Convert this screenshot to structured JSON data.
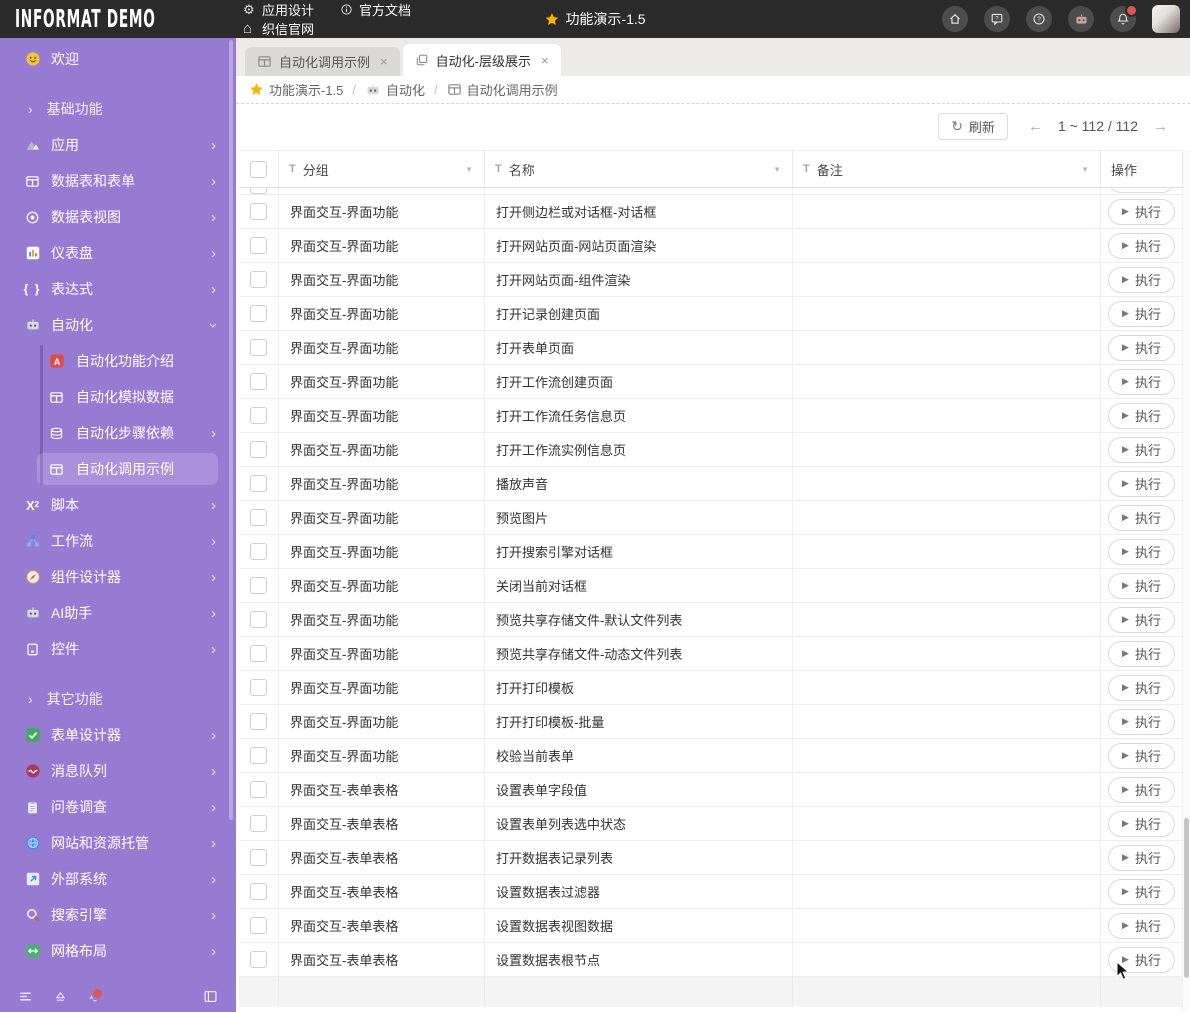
{
  "colors": {
    "accent_purple": "#977bd3",
    "topbar_bg": "#2b2b2b",
    "badge_red": "#e0564a",
    "star_yellow": "#f7b500"
  },
  "topbar": {
    "logo": "INFORMAT DEMO",
    "menu": [
      {
        "icon": "gear-icon",
        "label": "应用设计"
      },
      {
        "icon": "info-icon",
        "label": "官方文档"
      },
      {
        "icon": "home-icon",
        "label": "织信官网"
      }
    ],
    "title": {
      "icon": "star-icon",
      "label": "功能演示-1.5"
    },
    "actions": [
      {
        "icon": "home-circle-icon",
        "name": "home-button",
        "badge": false
      },
      {
        "icon": "feedback-icon",
        "name": "feedback-button",
        "badge": false
      },
      {
        "icon": "help-icon",
        "name": "help-button",
        "badge": false
      },
      {
        "icon": "ai-robot-icon",
        "name": "ai-assistant-button",
        "badge": false
      },
      {
        "icon": "bell-icon",
        "name": "notifications-button",
        "badge": true
      },
      {
        "icon": "avatar",
        "name": "user-avatar",
        "badge": false
      }
    ]
  },
  "sidebar": {
    "items": [
      {
        "type": "item",
        "icon": "smiley-icon",
        "label": "欢迎",
        "chevron": ""
      },
      {
        "type": "section",
        "label": "基础功能"
      },
      {
        "type": "item",
        "icon": "app-icon",
        "label": "应用",
        "chevron": "right"
      },
      {
        "type": "item",
        "icon": "table-icon",
        "label": "数据表和表单",
        "chevron": "right"
      },
      {
        "type": "item",
        "icon": "dataview-icon",
        "label": "数据表视图",
        "chevron": "right"
      },
      {
        "type": "item",
        "icon": "dashboard-icon",
        "label": "仪表盘",
        "chevron": "right"
      },
      {
        "type": "item",
        "icon": "expression-icon",
        "label": "表达式",
        "chevron": "right"
      },
      {
        "type": "item",
        "icon": "robot-icon",
        "label": "自动化",
        "chevron": "down"
      },
      {
        "type": "subitem",
        "icon": "a-badge-icon",
        "label": "自动化功能介绍",
        "chevron": ""
      },
      {
        "type": "subitem",
        "icon": "table-icon",
        "label": "自动化模拟数据",
        "chevron": ""
      },
      {
        "type": "subitem",
        "icon": "stack-icon",
        "label": "自动化步骤依赖",
        "chevron": "right"
      },
      {
        "type": "subitem",
        "icon": "table-icon",
        "label": "自动化调用示例",
        "chevron": "",
        "selected": true
      },
      {
        "type": "item",
        "icon": "script-icon",
        "label": "脚本",
        "chevron": "right"
      },
      {
        "type": "item",
        "icon": "workflow-icon",
        "label": "工作流",
        "chevron": "right"
      },
      {
        "type": "item",
        "icon": "compass-icon",
        "label": "组件设计器",
        "chevron": "right"
      },
      {
        "type": "item",
        "icon": "robot-icon",
        "label": "AI助手",
        "chevron": "right"
      },
      {
        "type": "item",
        "icon": "control-icon",
        "label": "控件",
        "chevron": "right"
      },
      {
        "type": "section",
        "label": "其它功能"
      },
      {
        "type": "item",
        "icon": "form-designer-icon",
        "label": "表单设计器",
        "chevron": "right"
      },
      {
        "type": "item",
        "icon": "message-queue-icon",
        "label": "消息队列",
        "chevron": "right"
      },
      {
        "type": "item",
        "icon": "survey-icon",
        "label": "问卷调查",
        "chevron": "right"
      },
      {
        "type": "item",
        "icon": "website-icon",
        "label": "网站和资源托管",
        "chevron": "right"
      },
      {
        "type": "item",
        "icon": "external-icon",
        "label": "外部系统",
        "chevron": "right"
      },
      {
        "type": "item",
        "icon": "search-icon",
        "label": "搜索引擎",
        "chevron": "right"
      },
      {
        "type": "item",
        "icon": "grid-icon",
        "label": "网格布局",
        "chevron": "right"
      }
    ],
    "footer_icons": [
      {
        "icon": "menu-icon",
        "name": "collapse-menu-button",
        "badge": false
      },
      {
        "icon": "eject-icon",
        "name": "eject-button",
        "badge": false
      },
      {
        "icon": "bell-icon",
        "name": "sidebar-notifications-button",
        "badge": true
      },
      {
        "icon": "spacer"
      },
      {
        "icon": "panel-icon",
        "name": "collapse-sidebar-button",
        "badge": false
      }
    ]
  },
  "tabs": [
    {
      "icon": "table-icon",
      "label": "自动化调用示例",
      "close": "×",
      "active": false
    },
    {
      "icon": "layers-icon",
      "label": "自动化-层级展示",
      "close": "×",
      "active": true
    }
  ],
  "breadcrumb": [
    {
      "icon": "star-icon",
      "label": "功能演示-1.5"
    },
    {
      "icon": "robot-icon",
      "label": "自动化"
    },
    {
      "icon": "table-icon",
      "label": "自动化调用示例"
    }
  ],
  "breadcrumb_separator": "/",
  "toolbar": {
    "refresh_label": "刷新",
    "pagination": "1 ~ 112 / 112"
  },
  "table": {
    "columns": [
      {
        "key": "group",
        "label": "分组",
        "filterable": true
      },
      {
        "key": "name",
        "label": "名称",
        "filterable": true
      },
      {
        "key": "note",
        "label": "备注",
        "filterable": true
      },
      {
        "key": "action",
        "label": "操作",
        "filterable": false
      }
    ],
    "action_label": "执行",
    "rows": [
      {
        "group": "界面交互-界面功能",
        "name": "打开侧边栏或对话框-对话框",
        "note": ""
      },
      {
        "group": "界面交互-界面功能",
        "name": "打开网站页面-网站页面渲染",
        "note": ""
      },
      {
        "group": "界面交互-界面功能",
        "name": "打开网站页面-组件渲染",
        "note": ""
      },
      {
        "group": "界面交互-界面功能",
        "name": "打开记录创建页面",
        "note": ""
      },
      {
        "group": "界面交互-界面功能",
        "name": "打开表单页面",
        "note": ""
      },
      {
        "group": "界面交互-界面功能",
        "name": "打开工作流创建页面",
        "note": ""
      },
      {
        "group": "界面交互-界面功能",
        "name": "打开工作流任务信息页",
        "note": ""
      },
      {
        "group": "界面交互-界面功能",
        "name": "打开工作流实例信息页",
        "note": ""
      },
      {
        "group": "界面交互-界面功能",
        "name": "播放声音",
        "note": ""
      },
      {
        "group": "界面交互-界面功能",
        "name": "预览图片",
        "note": ""
      },
      {
        "group": "界面交互-界面功能",
        "name": "打开搜索引擎对话框",
        "note": ""
      },
      {
        "group": "界面交互-界面功能",
        "name": "关闭当前对话框",
        "note": ""
      },
      {
        "group": "界面交互-界面功能",
        "name": "预览共享存储文件-默认文件列表",
        "note": ""
      },
      {
        "group": "界面交互-界面功能",
        "name": "预览共享存储文件-动态文件列表",
        "note": ""
      },
      {
        "group": "界面交互-界面功能",
        "name": "打开打印模板",
        "note": ""
      },
      {
        "group": "界面交互-界面功能",
        "name": "打开打印模板-批量",
        "note": ""
      },
      {
        "group": "界面交互-界面功能",
        "name": "校验当前表单",
        "note": ""
      },
      {
        "group": "界面交互-表单表格",
        "name": "设置表单字段值",
        "note": ""
      },
      {
        "group": "界面交互-表单表格",
        "name": "设置表单列表选中状态",
        "note": ""
      },
      {
        "group": "界面交互-表单表格",
        "name": "打开数据表记录列表",
        "note": ""
      },
      {
        "group": "界面交互-表单表格",
        "name": "设置数据表过滤器",
        "note": ""
      },
      {
        "group": "界面交互-表单表格",
        "name": "设置数据表视图数据",
        "note": ""
      },
      {
        "group": "界面交互-表单表格",
        "name": "设置数据表根节点",
        "note": ""
      }
    ]
  }
}
